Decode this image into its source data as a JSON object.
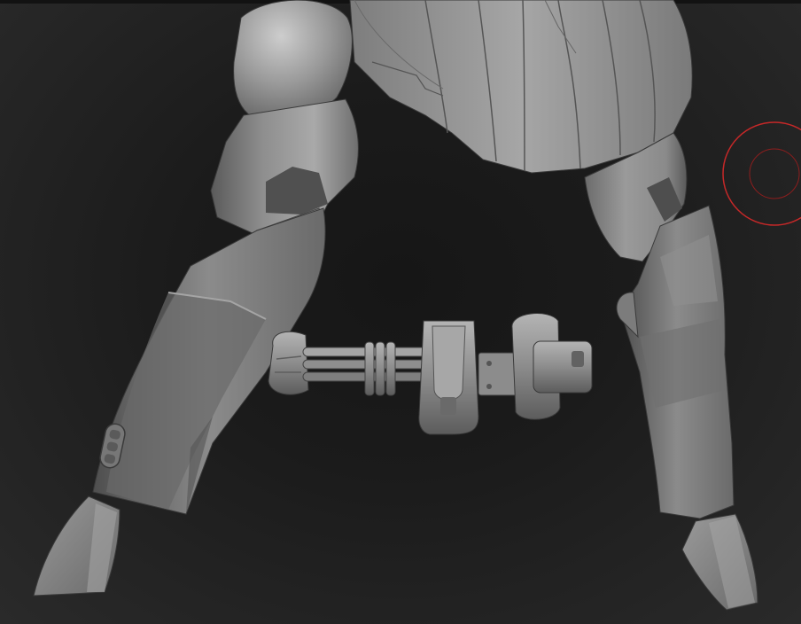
{
  "viewport": {
    "background_color": "#202020",
    "model_color": "#8a8a8a",
    "brush_cursor_color": "#c62828",
    "cursor_icon": "brush-cursor-icon"
  }
}
